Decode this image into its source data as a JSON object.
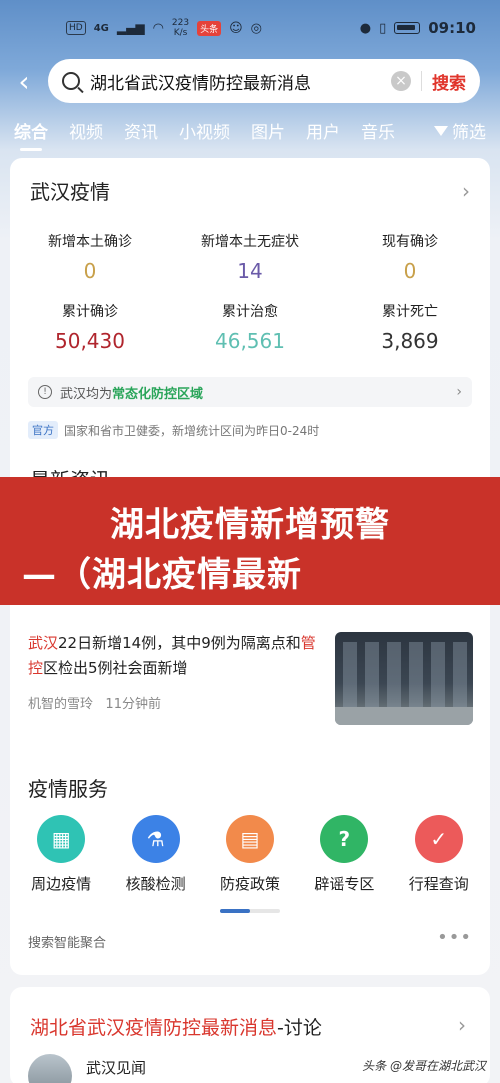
{
  "statusbar": {
    "hd": "HD",
    "signal": "4G",
    "speed_value": "223",
    "speed_unit": "K/s",
    "app_badge": "头条",
    "time": "09:10"
  },
  "search": {
    "query": "湖北省武汉疫情防控最新消息",
    "button": "搜索"
  },
  "tabs": [
    "综合",
    "视频",
    "资讯",
    "小视频",
    "图片",
    "用户",
    "音乐"
  ],
  "filter_label": "筛选",
  "epidemic": {
    "title": "武汉疫情",
    "stats": [
      {
        "label": "新增本土确诊",
        "value": "0",
        "color": "#c8a04a"
      },
      {
        "label": "新增本土无症状",
        "value": "14",
        "color": "#6a5aa8"
      },
      {
        "label": "现有确诊",
        "value": "0",
        "color": "#c8a04a"
      },
      {
        "label": "累计确诊",
        "value": "50,430",
        "color": "#b0252d"
      },
      {
        "label": "累计治愈",
        "value": "46,561",
        "color": "#5fbfb2"
      },
      {
        "label": "累计死亡",
        "value": "3,869",
        "color": "#333333"
      }
    ],
    "notice_prefix": "武汉均为",
    "notice_highlight": "常态化防控区域",
    "source_badge": "官方",
    "source_text": "国家和省市卫健委，新增统计区间为昨日0-24时",
    "latest_title": "最新资讯"
  },
  "banner": {
    "line1": "湖北疫情新增预警",
    "line2": "—（湖北疫情最新"
  },
  "news": {
    "hl1": "武汉",
    "t1": "22日新增14例，其中9例为隔离点和",
    "hl2": "管控",
    "t2": "区检出5例社会面新增",
    "author": "机智的雪玲",
    "time": "11分钟前"
  },
  "services": {
    "title": "疫情服务",
    "items": [
      {
        "label": "周边疫情",
        "icon": "building-icon",
        "color": "#2fc3b4"
      },
      {
        "label": "核酸检测",
        "icon": "flask-icon",
        "color": "#3c82e6"
      },
      {
        "label": "防疫政策",
        "icon": "policy-icon",
        "color": "#f28a4b"
      },
      {
        "label": "辟谣专区",
        "icon": "question-icon",
        "color": "#30b565"
      },
      {
        "label": "行程查询",
        "icon": "itinerary-icon",
        "color": "#ec5a5a"
      }
    ],
    "aggregation": "搜索智能聚合"
  },
  "discussion": {
    "title_hl": "湖北省武汉疫情防控最新消息",
    "title_suffix": "-讨论",
    "author": "武汉见闻"
  },
  "watermark": "头条 @发哥在湖北武汉"
}
